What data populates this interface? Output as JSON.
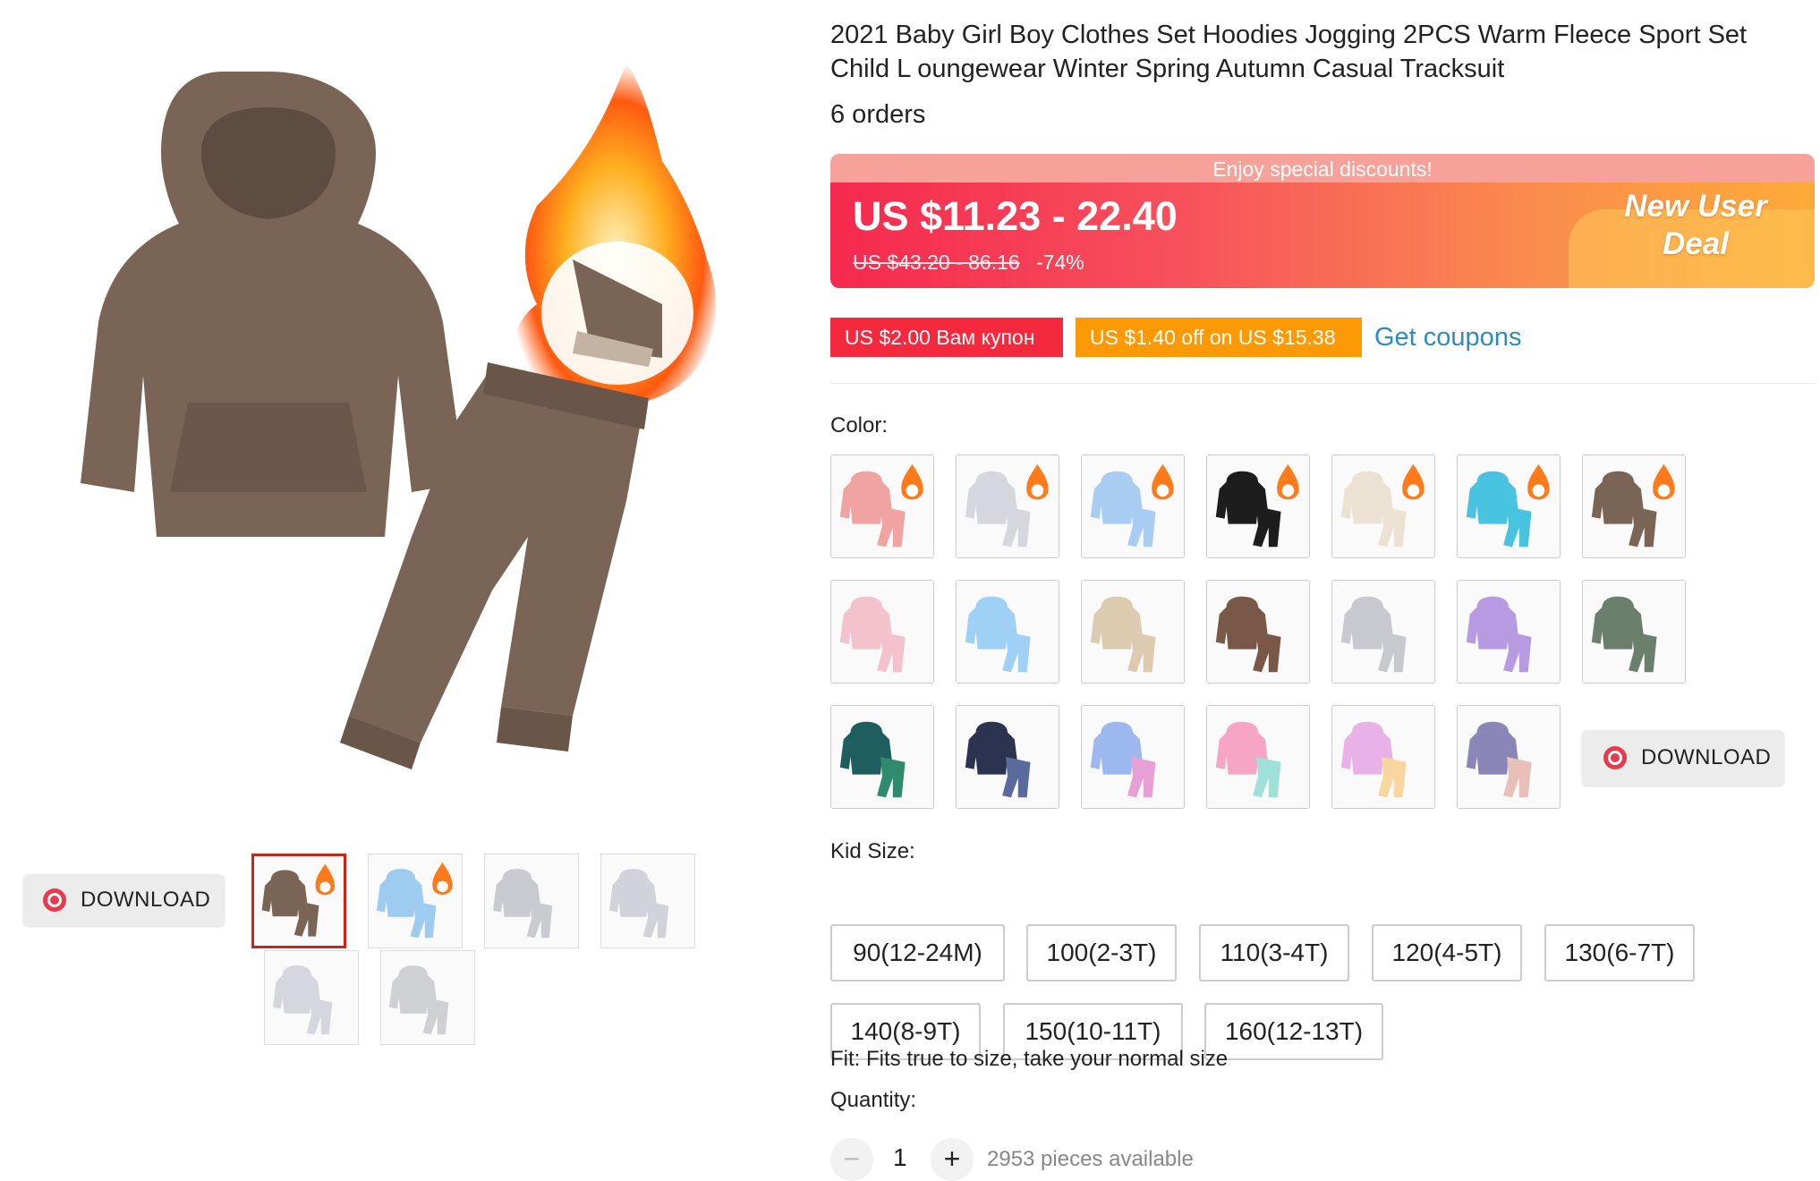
{
  "product": {
    "title": "2021 Baby Girl Boy Clothes Set Hoodies Jogging 2PCS Warm Fleece Sport Set Child L oungewear Winter Spring Autumn Casual Tracksuit",
    "orders": "6 orders"
  },
  "price_banner": {
    "top_text": "Enjoy special discounts!",
    "price_range": "US $11.23 - 22.40",
    "old_price": "US $43.20 - 86.16",
    "discount": "-74%",
    "deal_label": "New User Deal"
  },
  "coupons": {
    "coupon1": "US $2.00 Вам купон",
    "coupon2": "US $1.40 off on US $15.38",
    "get_coupons": "Get coupons"
  },
  "gallery": {
    "download_label": "DOWNLOAD",
    "thumbnails": [
      {
        "color": "#7a6456",
        "selected": true
      },
      {
        "color": "#9ecbf0",
        "selected": false
      },
      {
        "color": "#c9cbd1",
        "selected": false
      },
      {
        "color": "#d2d3da",
        "selected": false
      },
      {
        "color": "#d6d7de",
        "selected": false
      },
      {
        "color": "#cfd0d4",
        "selected": false
      }
    ]
  },
  "color": {
    "label": "Color:",
    "download_label": "DOWNLOAD",
    "swatches": [
      {
        "color": "#f0a3a0",
        "accent": "#f0a3a0",
        "flame": true
      },
      {
        "color": "#d6d6de",
        "accent": "#d6d6de",
        "flame": true
      },
      {
        "color": "#a9cdf2",
        "accent": "#a9cdf2",
        "flame": true
      },
      {
        "color": "#1d1d1d",
        "accent": "#1d1d1d",
        "flame": true
      },
      {
        "color": "#ece2d4",
        "accent": "#ece2d4",
        "flame": true
      },
      {
        "color": "#48c4e0",
        "accent": "#48c4e0",
        "flame": true
      },
      {
        "color": "#7a6456",
        "accent": "#7a6456",
        "flame": true
      },
      {
        "color": "#f4c2cc",
        "accent": "#f4c2cc",
        "flame": false
      },
      {
        "color": "#9fd0f5",
        "accent": "#9fd0f5",
        "flame": false
      },
      {
        "color": "#dccbb0",
        "accent": "#dccbb0",
        "flame": false
      },
      {
        "color": "#7a5848",
        "accent": "#7a5848",
        "flame": false
      },
      {
        "color": "#c8c9cf",
        "accent": "#c8c9cf",
        "flame": false
      },
      {
        "color": "#b79ae2",
        "accent": "#b79ae2",
        "flame": false
      },
      {
        "color": "#6a7f6c",
        "accent": "#6a7f6c",
        "flame": false
      },
      {
        "color": "#1f5e5e",
        "accent": "#2f8a6e",
        "flame": false
      },
      {
        "color": "#2c3350",
        "accent": "#5a6a9a",
        "flame": false
      },
      {
        "color": "#9db8ef",
        "accent": "#e6a0d6",
        "flame": false
      },
      {
        "color": "#f6a6c4",
        "accent": "#9fe0d8",
        "flame": false
      },
      {
        "color": "#e8b2e8",
        "accent": "#f7d6a0",
        "flame": false
      },
      {
        "color": "#8a86b8",
        "accent": "#e8c0b8",
        "flame": false
      }
    ]
  },
  "size": {
    "label": "Kid Size:",
    "options": [
      "90(12-24M)",
      "100(2-3T)",
      "110(3-4T)",
      "120(4-5T)",
      "130(6-7T)",
      "140(8-9T)",
      "150(10-11T)",
      "160(12-13T)"
    ]
  },
  "fit": "Fit: Fits true to size, take your normal size",
  "quantity": {
    "label": "Quantity:",
    "minus": "−",
    "value": "1",
    "plus": "+",
    "available": "2953 pieces available"
  }
}
